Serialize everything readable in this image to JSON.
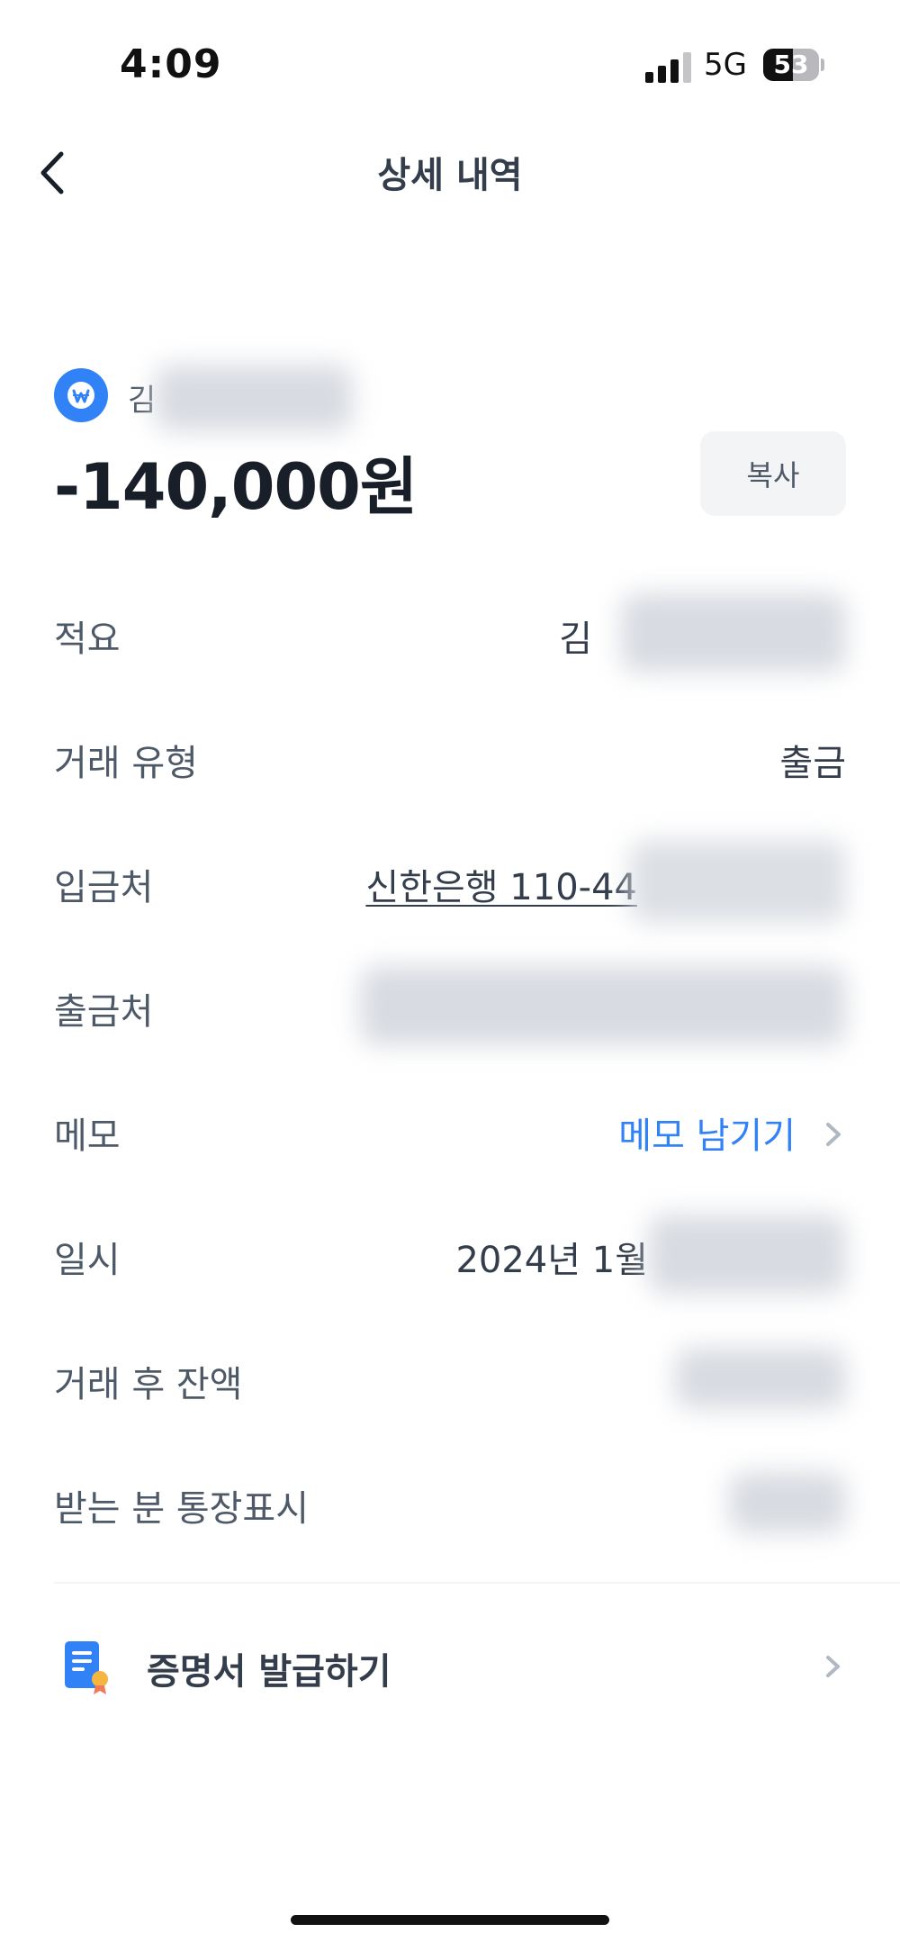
{
  "status_bar": {
    "time": "4:09",
    "network": "5G",
    "battery_level": "53",
    "battery_fraction": 0.53
  },
  "header": {
    "title": "상세 내역",
    "back_icon": "chevron-left-icon"
  },
  "summary": {
    "bank_logo_icon": "won-icon",
    "counterparty_visible": "김",
    "amount": "-140,000원",
    "copy_label": "복사"
  },
  "details": [
    {
      "label": "적요",
      "value": "김"
    },
    {
      "label": "거래 유형",
      "value": "출금"
    },
    {
      "label": "입금처",
      "value": "신한은행 110-44"
    },
    {
      "label": "출금처",
      "value": ""
    },
    {
      "label": "메모",
      "value": "메모 남기기"
    },
    {
      "label": "일시",
      "value": "2024년 1월"
    },
    {
      "label": "거래 후 잔액",
      "value": ""
    },
    {
      "label": "받는 분 통장표시",
      "value": ""
    }
  ],
  "certificate": {
    "label": "증명서 발급하기",
    "icon": "certificate-document-icon"
  },
  "colors": {
    "accent": "#3182f6",
    "primary_text": "#191f28",
    "secondary_text": "#4e5968",
    "button_bg": "#f2f4f6"
  }
}
